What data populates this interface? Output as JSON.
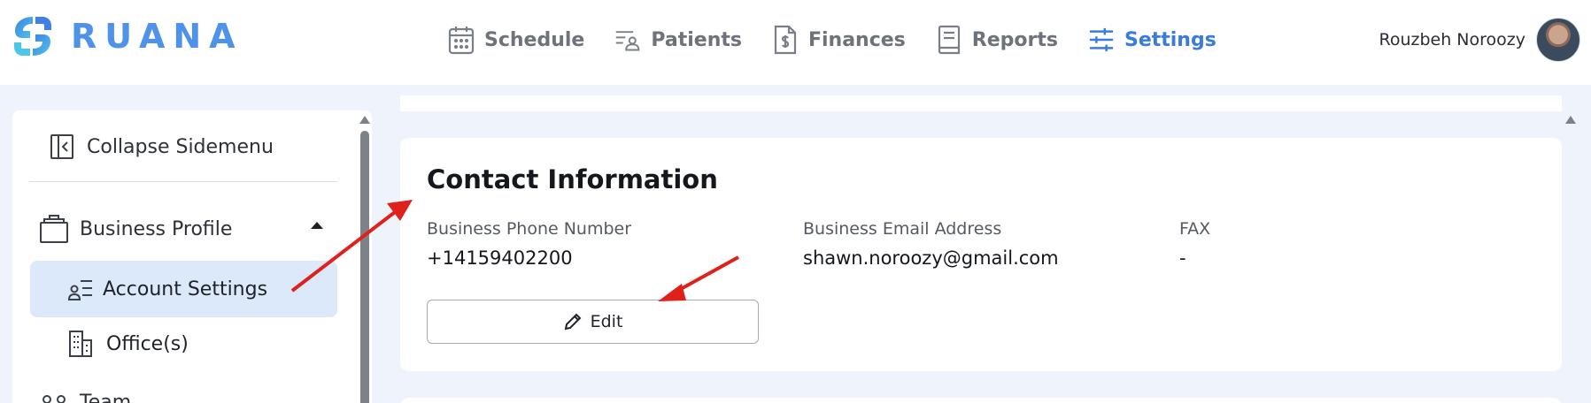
{
  "brand": {
    "name": "RUANA"
  },
  "nav": {
    "items": [
      {
        "label": "Schedule",
        "icon": "calendar-icon"
      },
      {
        "label": "Patients",
        "icon": "patients-icon"
      },
      {
        "label": "Finances",
        "icon": "invoice-dollar-icon"
      },
      {
        "label": "Reports",
        "icon": "report-icon"
      },
      {
        "label": "Settings",
        "icon": "sliders-icon",
        "active": true
      }
    ]
  },
  "user": {
    "name": "Rouzbeh Noroozy"
  },
  "sidebar": {
    "collapse_label": "Collapse Sidemenu",
    "group_label": "Business Profile",
    "items": [
      {
        "label": "Account Settings",
        "active": true
      },
      {
        "label": "Office(s)"
      }
    ],
    "next_group_label": "Team"
  },
  "contact": {
    "title": "Contact Information",
    "fields": [
      {
        "label": "Business Phone Number",
        "value": "+14159402200"
      },
      {
        "label": "Business Email Address",
        "value": "shawn.noroozy@gmail.com"
      },
      {
        "label": "FAX",
        "value": "-"
      }
    ],
    "edit_label": "Edit"
  },
  "colors": {
    "accent": "#3a7be0",
    "page_bg": "#eef3fc",
    "active_item_bg": "#dce9fb",
    "annotation_arrow": "#e0201b"
  }
}
